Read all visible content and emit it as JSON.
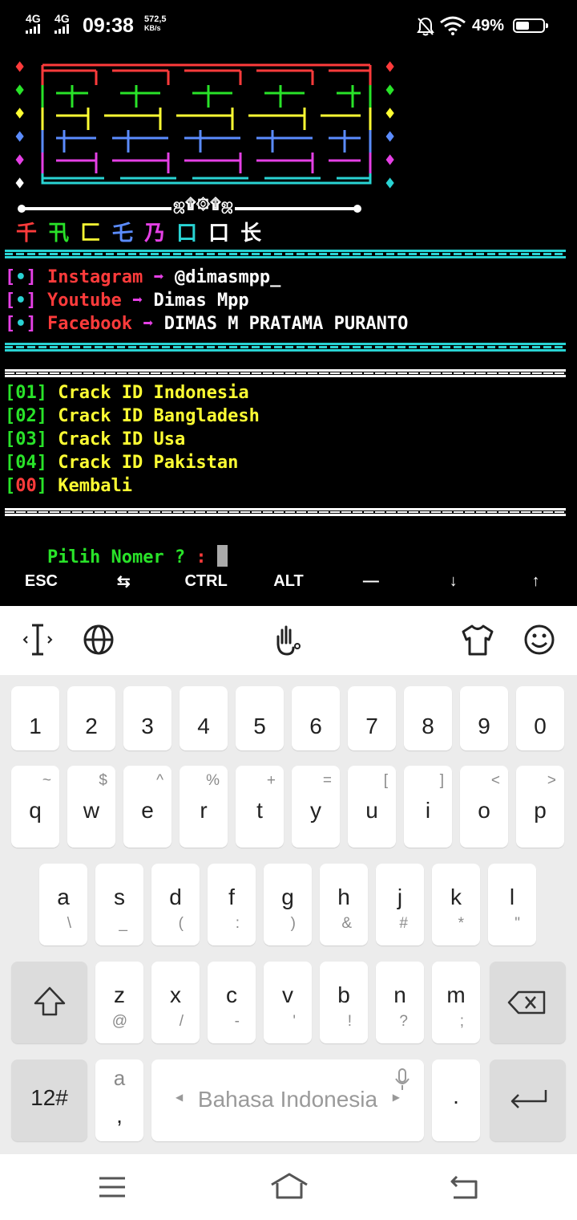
{
  "status_bar": {
    "net1": "4G",
    "net2": "4G",
    "time": "09:38",
    "speed_value": "572,5",
    "speed_unit": "KB/s",
    "battery": "49%",
    "battery_level": 0.49
  },
  "terminal": {
    "logo_caption": "ஜ۩۞۩ஜ",
    "banner": {
      "chars": [
        "千",
        "卂",
        "匚",
        "乇",
        "乃",
        "口",
        "口",
        "长"
      ],
      "colors": [
        "#ff3b3b",
        "#29e329",
        "#ffff33",
        "#5b8cff",
        "#e540e5",
        "#29d3d3",
        "#ffffff",
        "#ffffff"
      ]
    },
    "links": [
      {
        "bullet": "[•]",
        "name": "Instagram",
        "arrow": "➡",
        "value": "@dimasmpp_"
      },
      {
        "bullet": "[•]",
        "name": "Youtube",
        "arrow": "➡",
        "value": "Dimas Mpp"
      },
      {
        "bullet": "[•]",
        "name": "Facebook",
        "arrow": "➡",
        "value": "DIMAS M PRATAMA PURANTO"
      }
    ],
    "menu": [
      {
        "num": "01",
        "label": "Crack ID Indonesia"
      },
      {
        "num": "02",
        "label": "Crack ID Bangladesh"
      },
      {
        "num": "03",
        "label": "Crack ID Usa"
      },
      {
        "num": "04",
        "label": "Crack ID Pakistan"
      },
      {
        "num": "00",
        "label": "Kembali"
      }
    ],
    "prompt_label": "Pilih Nomer ? :",
    "colors": {
      "green": "#29e329",
      "yellow": "#ffff33",
      "red": "#ff3b3b",
      "magenta": "#e540e5",
      "cyan": "#29d3d3",
      "white": "#ffffff"
    }
  },
  "extra_keys": [
    "ESC",
    "⇆",
    "CTRL",
    "ALT",
    "—",
    "↓",
    "↑"
  ],
  "keyboard": {
    "toolbar_icons": [
      "text-cursor-icon",
      "globe-icon",
      "gesture-icon",
      "theme-shirt-icon",
      "emoji-icon"
    ],
    "row_numbers": [
      "1",
      "2",
      "3",
      "4",
      "5",
      "6",
      "7",
      "8",
      "9",
      "0"
    ],
    "row1": [
      {
        "k": "q",
        "s": "~"
      },
      {
        "k": "w",
        "s": "$"
      },
      {
        "k": "e",
        "s": "^"
      },
      {
        "k": "r",
        "s": "%"
      },
      {
        "k": "t",
        "s": "+"
      },
      {
        "k": "y",
        "s": "="
      },
      {
        "k": "u",
        "s": "["
      },
      {
        "k": "i",
        "s": "]"
      },
      {
        "k": "o",
        "s": "<"
      },
      {
        "k": "p",
        "s": ">"
      }
    ],
    "row2": [
      {
        "k": "a",
        "s": "\\"
      },
      {
        "k": "s",
        "s": "_"
      },
      {
        "k": "d",
        "s": "("
      },
      {
        "k": "f",
        "s": ":"
      },
      {
        "k": "g",
        "s": ")"
      },
      {
        "k": "h",
        "s": "&"
      },
      {
        "k": "j",
        "s": "#"
      },
      {
        "k": "k",
        "s": "*"
      },
      {
        "k": "l",
        "s": "\""
      }
    ],
    "row3": [
      {
        "k": "z",
        "s": "@"
      },
      {
        "k": "x",
        "s": "/"
      },
      {
        "k": "c",
        "s": "-"
      },
      {
        "k": "v",
        "s": "'"
      },
      {
        "k": "b",
        "s": "!"
      },
      {
        "k": "n",
        "s": "?"
      },
      {
        "k": "m",
        "s": ";"
      }
    ],
    "sym_label": "12#",
    "comma_main": "a",
    "comma_sub": ",",
    "space_label": "Bahasa Indonesia",
    "period": "."
  }
}
